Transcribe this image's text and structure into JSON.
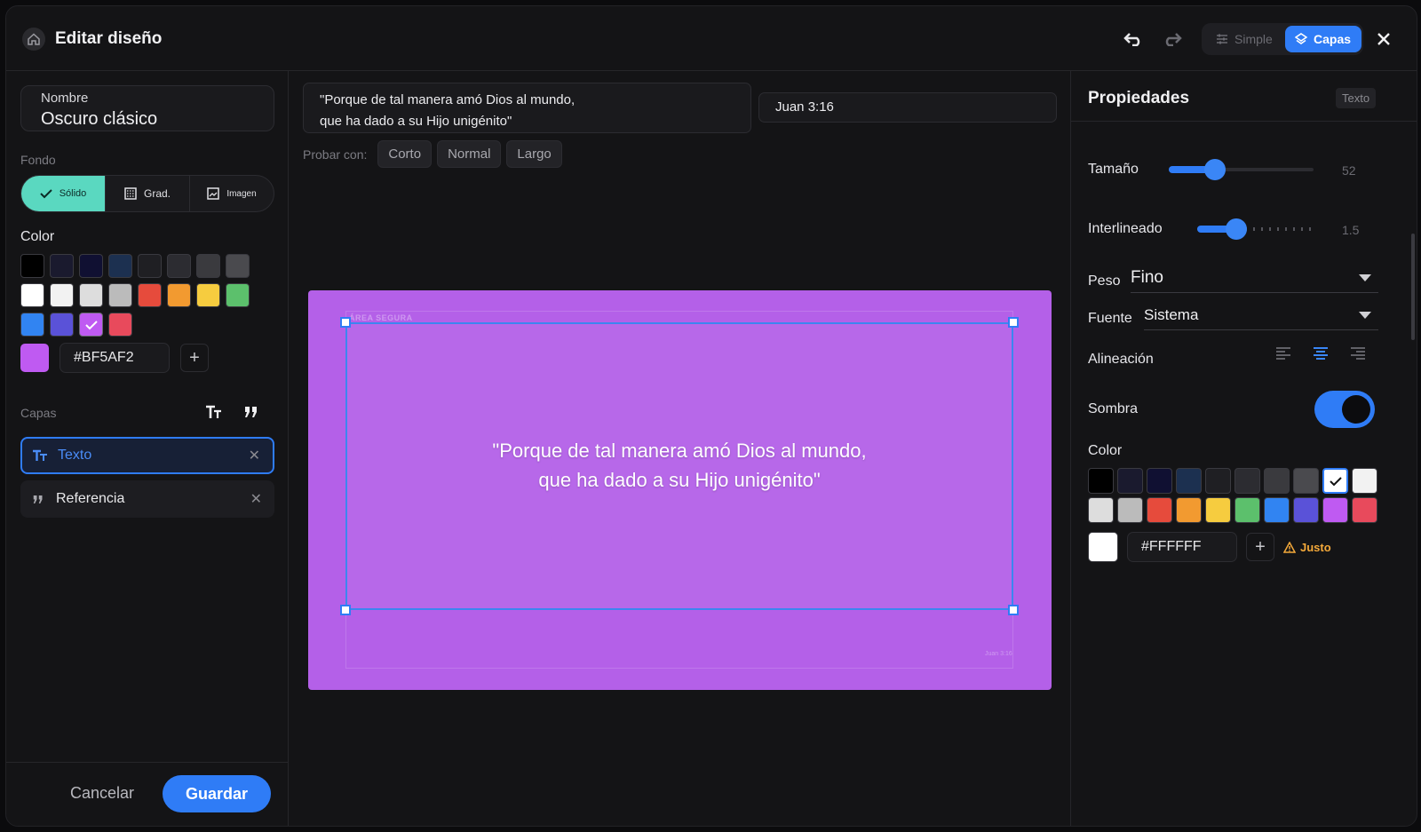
{
  "header": {
    "title": "Editar diseño",
    "mode_simple": "Simple",
    "mode_capas": "Capas"
  },
  "left": {
    "name_label": "Nombre",
    "name_value": "Oscuro clásico",
    "fondo_label": "Fondo",
    "bg_tabs": [
      {
        "label": "Sólido",
        "icon": "check-icon",
        "active": true
      },
      {
        "label": "Grad.",
        "icon": "gradient-icon",
        "active": false
      },
      {
        "label": "Imagen",
        "icon": "image-icon",
        "active": false
      }
    ],
    "color_label": "Color",
    "swatches": [
      "#000000",
      "#1a1a2e",
      "#101032",
      "#1c3050",
      "#1f1f23",
      "#2c2c31",
      "#3a3a3e",
      "#4a4a4e",
      "#ffffff",
      "#f2f2f2",
      "#dddddd",
      "#bbbbbb",
      "#e64b3c",
      "#f29a30",
      "#f6cc3f",
      "#5cc06c",
      "#3184f2",
      "#5a52d8",
      "#BF5AF2",
      "#e84a5c"
    ],
    "selected_swatch": 18,
    "hex_value": "#BF5AF2",
    "layers_label": "Capas",
    "layers": [
      {
        "label": "Texto",
        "icon": "text-icon",
        "active": true
      },
      {
        "label": "Referencia",
        "icon": "quote-icon",
        "active": false
      }
    ],
    "cancel_label": "Cancelar",
    "save_label": "Guardar"
  },
  "center": {
    "verse_text": "\"Porque de tal manera amó Dios al mundo,\nque ha dado a su Hijo unigénito\"",
    "reference_text": "Juan 3:16",
    "try_label": "Probar con:",
    "try_options": [
      "Corto",
      "Normal",
      "Largo"
    ],
    "safe_area_label": "ÁREA SEGURA",
    "canvas_text": "\"Porque de tal manera amó Dios al mundo,\nque ha dado a su Hijo unigénito\"",
    "canvas_ref": "Juan 3:16",
    "canvas_bg": "#BF5AF2"
  },
  "right": {
    "title": "Propiedades",
    "badge": "Texto",
    "size_label": "Tamaño",
    "size_value": "52",
    "line_label": "Interlineado",
    "line_value": "1.5",
    "weight_label": "Peso",
    "weight_value": "Fino",
    "font_label": "Fuente",
    "font_value": "Sistema",
    "align_label": "Alineación",
    "align_selected": "center",
    "shadow_label": "Sombra",
    "shadow_on": true,
    "color_label": "Color",
    "swatches": [
      "#000000",
      "#1a1a2e",
      "#101032",
      "#1c3050",
      "#1f1f23",
      "#2c2c31",
      "#3a3a3e",
      "#4a4a4e",
      "#ffffff",
      "#f2f2f2",
      "#dddddd",
      "#bbbbbb",
      "#e64b3c",
      "#f29a30",
      "#f6cc3f",
      "#5cc06c",
      "#3184f2",
      "#5a52d8",
      "#BF5AF2",
      "#e84a5c"
    ],
    "selected_swatch": 8,
    "hex_value": "#FFFFFF",
    "contrast_label": "Justo"
  }
}
